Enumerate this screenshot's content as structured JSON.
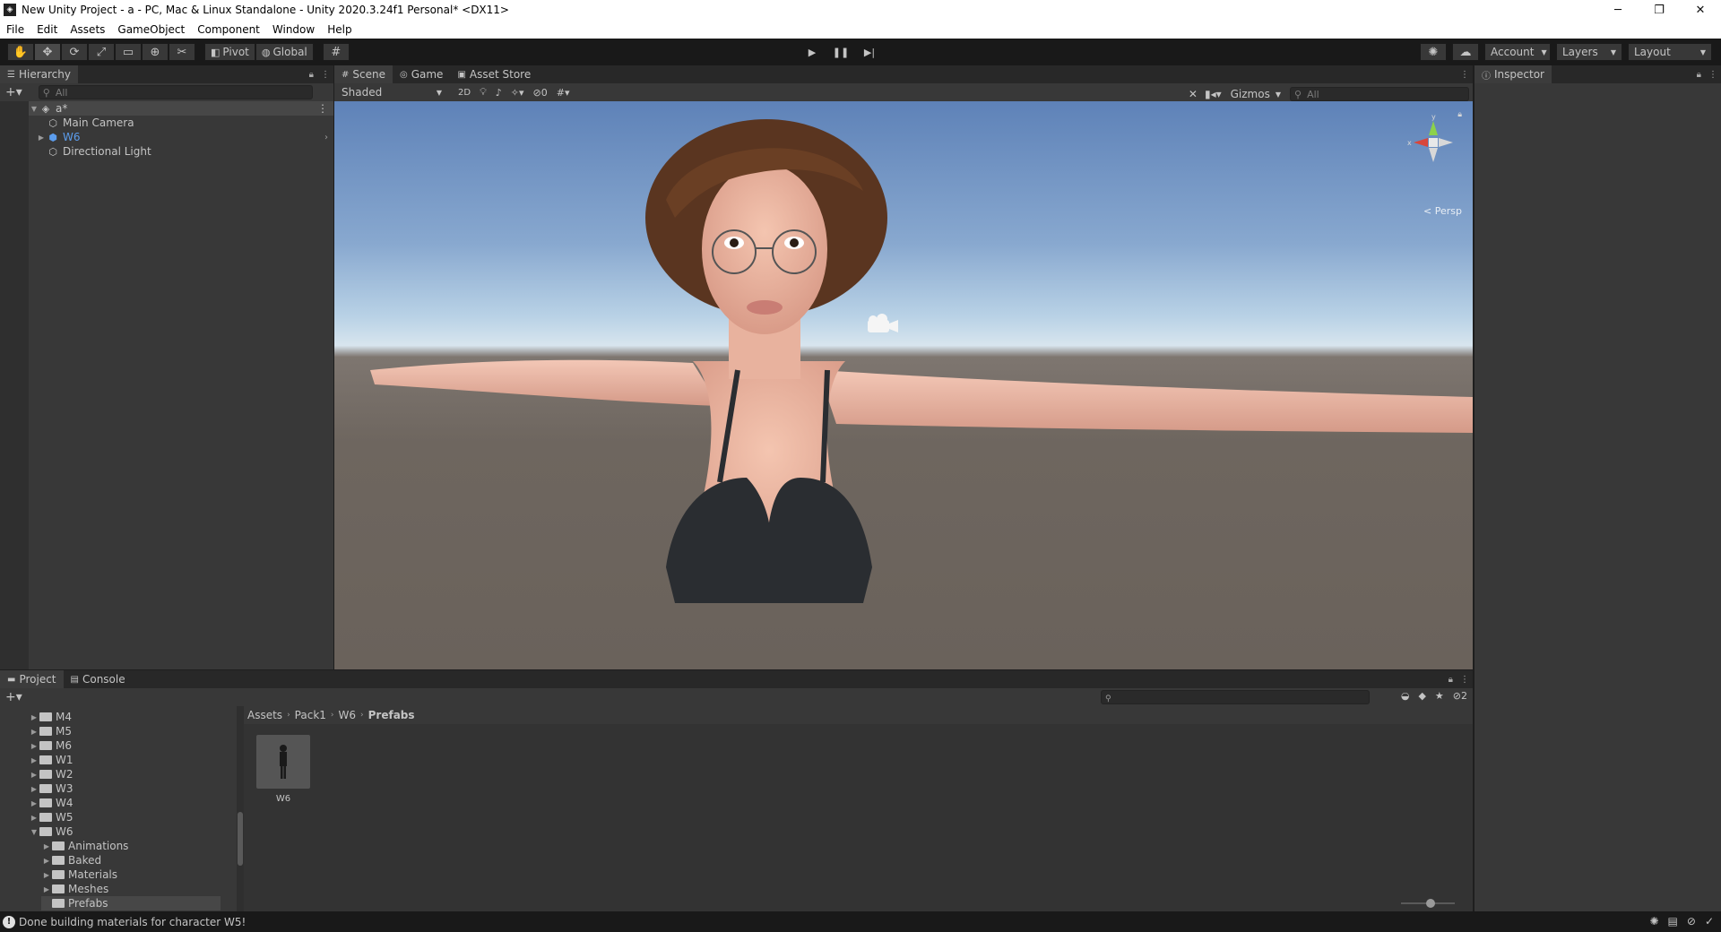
{
  "window": {
    "title": "New Unity Project - a - PC, Mac & Linux Standalone - Unity 2020.3.24f1 Personal* <DX11>",
    "app_icon": "◈",
    "minimize": "─",
    "restore": "❐",
    "close": "✕"
  },
  "menu": [
    "File",
    "Edit",
    "Assets",
    "GameObject",
    "Component",
    "Window",
    "Help"
  ],
  "toolbar": {
    "pivot_label": "Pivot",
    "global_label": "Global",
    "account_label": "Account",
    "layers_label": "Layers",
    "layout_label": "Layout"
  },
  "hierarchy": {
    "tab_label": "Hierarchy",
    "search_placeholder": "All",
    "scene_name": "a*",
    "items": [
      {
        "label": "Main Camera"
      },
      {
        "label": "W6"
      },
      {
        "label": "Directional Light"
      }
    ]
  },
  "scene": {
    "tabs": [
      "Scene",
      "Game",
      "Asset Store"
    ],
    "shading_mode": "Shaded",
    "mode_2d": "2D",
    "hidden_count": "0",
    "gizmos_label": "Gizmos",
    "search_placeholder": "All",
    "gizmo_axes": {
      "x": "x",
      "y": "y"
    },
    "persp_label": "< Persp"
  },
  "inspector": {
    "tab_label": "Inspector"
  },
  "project": {
    "tabs": [
      "Project",
      "Console"
    ],
    "hidden_count": "2",
    "tree": [
      {
        "label": "M4",
        "expanded": false,
        "level": 0
      },
      {
        "label": "M5",
        "expanded": false,
        "level": 0
      },
      {
        "label": "M6",
        "expanded": false,
        "level": 0
      },
      {
        "label": "W1",
        "expanded": false,
        "level": 0
      },
      {
        "label": "W2",
        "expanded": false,
        "level": 0
      },
      {
        "label": "W3",
        "expanded": false,
        "level": 0
      },
      {
        "label": "W4",
        "expanded": false,
        "level": 0
      },
      {
        "label": "W5",
        "expanded": false,
        "level": 0
      },
      {
        "label": "W6",
        "expanded": true,
        "level": 0
      },
      {
        "label": "Animations",
        "expanded": false,
        "level": 1
      },
      {
        "label": "Baked",
        "expanded": false,
        "level": 1
      },
      {
        "label": "Materials",
        "expanded": false,
        "level": 1
      },
      {
        "label": "Meshes",
        "expanded": false,
        "level": 1
      },
      {
        "label": "Prefabs",
        "expanded": false,
        "level": 1
      }
    ],
    "breadcrumb": [
      "Assets",
      "Pack1",
      "W6",
      "Prefabs"
    ],
    "assets": [
      {
        "name": "W6"
      }
    ]
  },
  "status": {
    "message": "Done building materials for character W5!"
  },
  "colors": {
    "editor_bg": "#383838",
    "panel_header": "#282828",
    "prefab_blue": "#5c9ded",
    "toolbar_bg": "#191919"
  }
}
